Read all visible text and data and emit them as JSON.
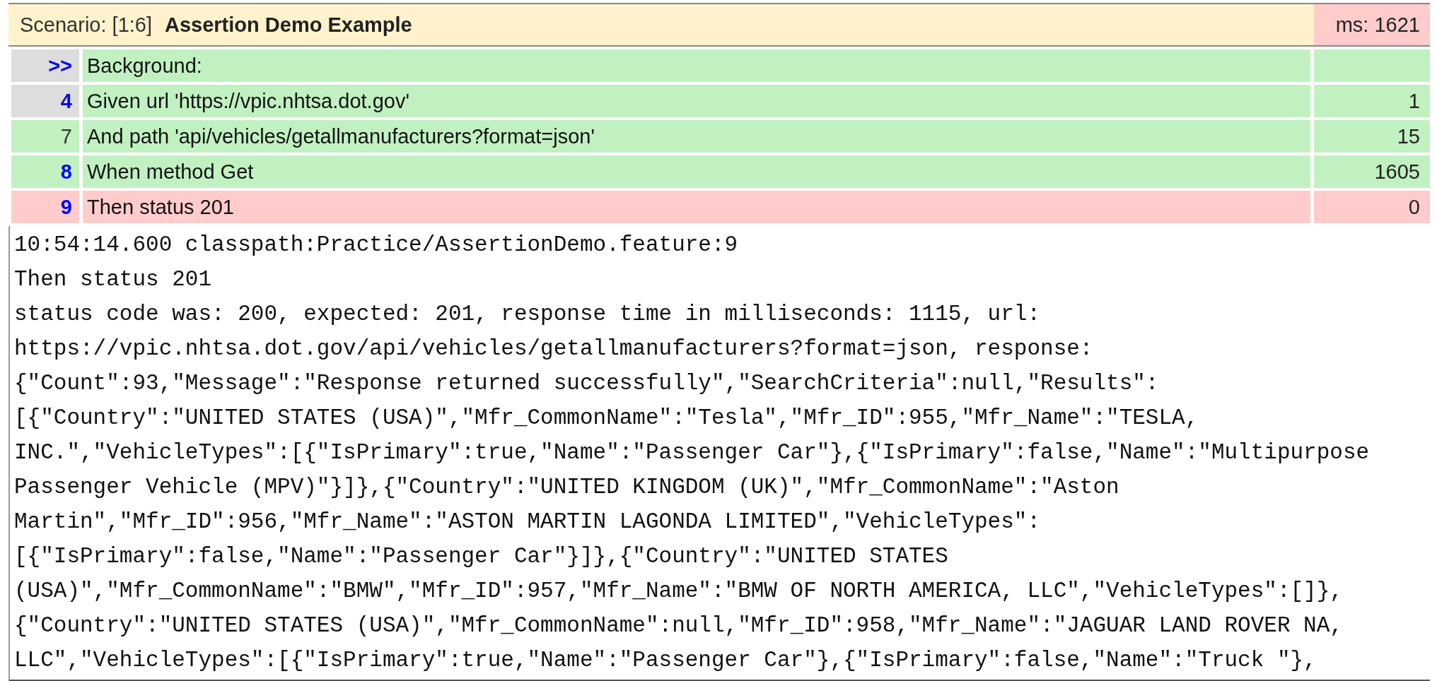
{
  "scenario": {
    "label": "Scenario: [1:6]",
    "title": "Assertion Demo Example",
    "time": "ms: 1621",
    "failed": true
  },
  "steps": [
    {
      "line": ">>",
      "text": "Background:",
      "failed": false,
      "linked": true,
      "gutter_grey": true
    },
    {
      "line": "4",
      "text": "Given url 'https://vpic.nhtsa.dot.gov'",
      "time": "1",
      "failed": false,
      "linked": true,
      "gutter_grey": true
    },
    {
      "line": "7",
      "text": "And path 'api/vehicles/getallmanufacturers?format=json'",
      "time": "15",
      "failed": false,
      "linked": false,
      "gutter_grey": false
    },
    {
      "line": "8",
      "text": "When method Get",
      "time": "1605",
      "failed": false,
      "linked": true,
      "gutter_grey": false
    },
    {
      "line": "9",
      "text": "Then status 201",
      "time": "0",
      "failed": true,
      "linked": true,
      "gutter_grey": false
    }
  ],
  "log": [
    "10:54:14.600 classpath:Practice/AssertionDemo.feature:9",
    "Then status 201",
    "status code was: 200, expected: 201, response time in milliseconds: 1115, url:",
    "https://vpic.nhtsa.dot.gov/api/vehicles/getallmanufacturers?format=json, response:",
    "{\"Count\":93,\"Message\":\"Response returned successfully\",\"SearchCriteria\":null,\"Results\":",
    "[{\"Country\":\"UNITED STATES (USA)\",\"Mfr_CommonName\":\"Tesla\",\"Mfr_ID\":955,\"Mfr_Name\":\"TESLA,",
    "INC.\",\"VehicleTypes\":[{\"IsPrimary\":true,\"Name\":\"Passenger Car\"},{\"IsPrimary\":false,\"Name\":\"Multipurpose",
    "Passenger Vehicle (MPV)\"}]},{\"Country\":\"UNITED KINGDOM (UK)\",\"Mfr_CommonName\":\"Aston",
    "Martin\",\"Mfr_ID\":956,\"Mfr_Name\":\"ASTON MARTIN LAGONDA LIMITED\",\"VehicleTypes\":",
    "[{\"IsPrimary\":false,\"Name\":\"Passenger Car\"}]},{\"Country\":\"UNITED STATES",
    "(USA)\",\"Mfr_CommonName\":\"BMW\",\"Mfr_ID\":957,\"Mfr_Name\":\"BMW OF NORTH AMERICA, LLC\",\"VehicleTypes\":[]},",
    "{\"Country\":\"UNITED STATES (USA)\",\"Mfr_CommonName\":null,\"Mfr_ID\":958,\"Mfr_Name\":\"JAGUAR LAND ROVER NA,",
    "LLC\",\"VehicleTypes\":[{\"IsPrimary\":true,\"Name\":\"Passenger Car\"},{\"IsPrimary\":false,\"Name\":\"Truck \"},"
  ]
}
